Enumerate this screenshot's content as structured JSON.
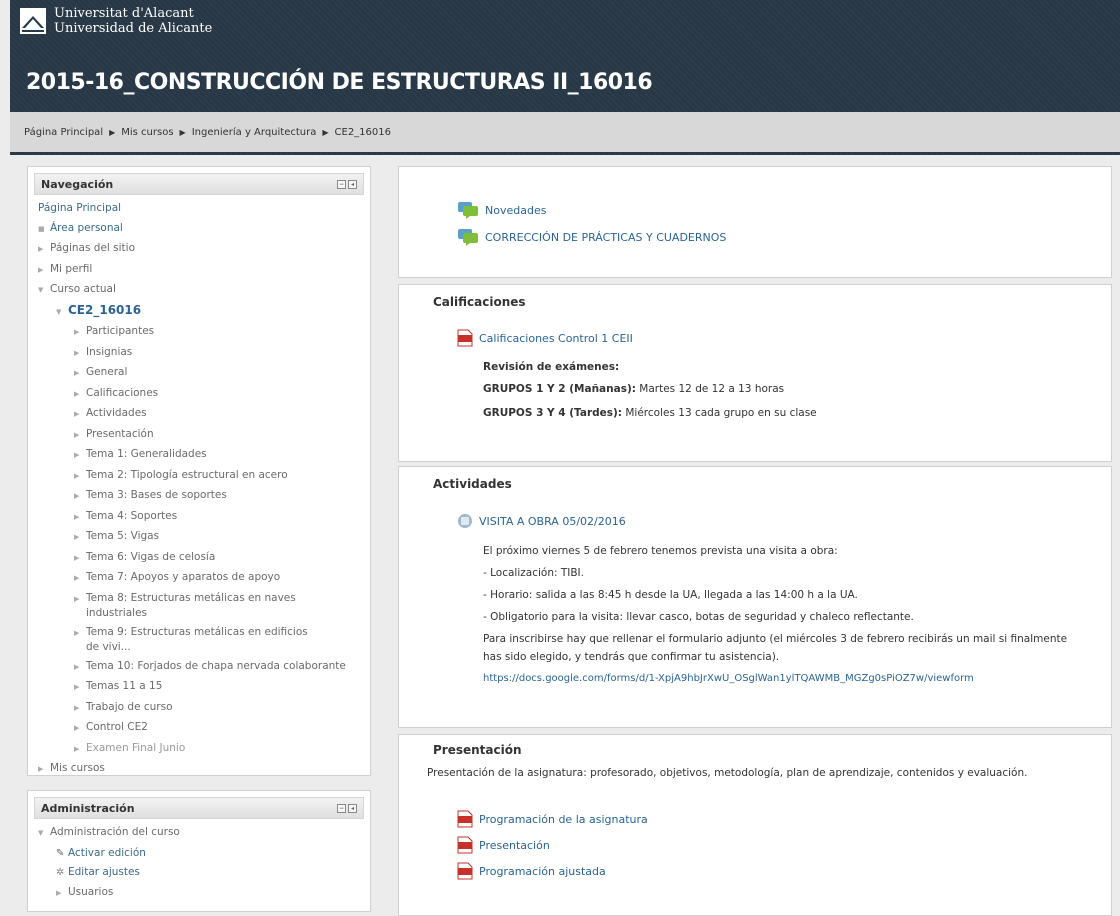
{
  "header": {
    "university_line1": "Universitat d'Alacant",
    "university_line2": "Universidad de Alicante",
    "course_title": "2015-16_CONSTRUCCIÓN DE ESTRUCTURAS II_16016"
  },
  "breadcrumb": [
    "Página Principal",
    "Mis cursos",
    "Ingeniería y Arquitectura",
    "CE2_16016"
  ],
  "navigation": {
    "title": "Navegación",
    "home": "Página Principal",
    "area_personal": "Área personal",
    "paginas_sitio": "Páginas del sitio",
    "mi_perfil": "Mi perfil",
    "curso_actual": "Curso actual",
    "course_code": "CE2_16016",
    "course_items": [
      "Participantes",
      "Insignias",
      "General",
      "Calificaciones",
      "Actividades",
      "Presentación",
      "Tema 1: Generalidades",
      "Tema 2: Tipología estructural en acero",
      "Tema 3: Bases de soportes",
      "Tema 4: Soportes",
      "Tema 5: Vigas",
      "Tema 6: Vigas de celosía",
      "Tema 7: Apoyos y aparatos de apoyo"
    ],
    "tema8": "Tema 8: Estructuras metálicas en naves industriales",
    "tema9": "Tema 9: Estructuras metálicas en edificios de vivi...",
    "course_items_2": [
      "Tema 10: Forjados de chapa nervada colaborante",
      "Temas 11 a 15",
      "Trabajo de curso",
      "Control CE2"
    ],
    "examen_final": "Examen Final Junio",
    "mis_cursos": "Mis cursos"
  },
  "administration": {
    "title": "Administración",
    "admin_curso": "Administración del curso",
    "activar_edicion": "Activar edición",
    "editar_ajustes": "Editar ajustes",
    "usuarios": "Usuarios"
  },
  "forums": {
    "novedades": "Novedades",
    "correccion": "CORRECCIÓN DE PRÁCTICAS Y CUADERNOS"
  },
  "calificaciones": {
    "title": "Calificaciones",
    "file": "Calificaciones Control 1 CEII",
    "revision_label": "Revisión de exámenes:",
    "grupos12_label": "GRUPOS 1 Y 2 (Mañanas):",
    "grupos12_text": "Martes 12 de 12 a 13 horas",
    "grupos34_label": "GRUPOS 3 Y 4 (Tardes):",
    "grupos34_text": "Miércoles 13 cada grupo en su clase"
  },
  "actividades": {
    "title": "Actividades",
    "visita": "VISITA A OBRA 05/02/2016",
    "line1": "El próximo viernes 5 de febrero tenemos prevista una visita a obra:",
    "line2": "- Localización: TIBI.",
    "line3": "- Horario: salida a las 8:45 h desde la UA, llegada a las 14:00 h a la UA.",
    "line4": "- Obligatorio para la visita: llevar casco, botas de seguridad y chaleco reflectante.",
    "line5a": "Para inscribirse hay que rellenar el formulario adjunto (el miércoles 3 de febrero recibirás un mail si finalmente",
    "line5b": "has sido elegido, y tendrás que confirmar tu asistencia).",
    "url": "https://docs.google.com/forms/d/1-XpjA9hbJrXwU_OSglWan1ylTQAWMB_MGZg0sPiOZ7w/viewform"
  },
  "presentacion": {
    "title": "Presentación",
    "desc": "Presentación de la asignatura: profesorado, objetivos, metodología, plan de aprendizaje, contenidos y evaluación.",
    "files": [
      "Programación de la asignatura",
      "Presentación",
      "Programación ajustada"
    ]
  },
  "colors": {
    "header_bg": "#283847",
    "link": "#2a6496",
    "pdf_red": "#c8302a",
    "forum_green": "#7dbf3a"
  }
}
